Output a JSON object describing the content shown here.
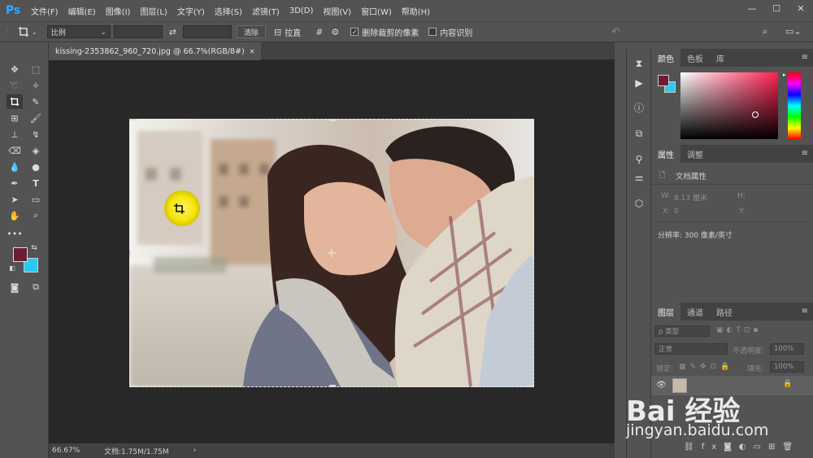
{
  "app": {
    "logo": "Ps"
  },
  "menu": [
    "文件(F)",
    "编辑(E)",
    "图像(I)",
    "图层(L)",
    "文字(Y)",
    "选择(S)",
    "滤镜(T)",
    "3D(D)",
    "视图(V)",
    "窗口(W)",
    "帮助(H)"
  ],
  "window_controls": {
    "minimize": "—",
    "maximize": "☐",
    "close": "✕"
  },
  "options": {
    "ratio": "比例",
    "clear_label": "清除",
    "straighten_label": "拉直",
    "delete_cropped_label": "删除裁剪的像素",
    "delete_cropped_checked": true,
    "content_aware_label": "内容识别",
    "content_aware_checked": false
  },
  "document": {
    "tab_title": "kissing-2353862_960_720.jpg @ 66.7%(RGB/8#)",
    "tab_close": "✕",
    "zoom": "66.67%",
    "doc_info": "文档:1.75M/1.75M",
    "status_arrow": "›"
  },
  "colors": {
    "foreground": "#6b1e33",
    "background": "#29c9f3",
    "accent": "#31a8ff",
    "highlight": "#f5e50a"
  },
  "color_panel": {
    "tabs": [
      "颜色",
      "色板",
      "库"
    ]
  },
  "properties_panel": {
    "tabs": [
      "属性",
      "调整"
    ],
    "section_title": "文档属性",
    "w_label": "W:",
    "w_value": "8.13 厘米",
    "h_label": "H:",
    "x_label": "X:",
    "x_value": "0",
    "y_label": "Y:",
    "resolution": "分辨率: 300 像素/英寸"
  },
  "layers_panel": {
    "tabs": [
      "图层",
      "通道",
      "路径"
    ],
    "filter_placeholder": "ρ 类型",
    "blend_mode": "正常",
    "opacity_label": "不透明度:",
    "opacity_value": "100%",
    "lock_label": "锁定:",
    "fill_label": "填充:",
    "fill_value": "100%"
  },
  "watermark": {
    "text": "Bai 经验",
    "url": "jingyan.baidu.com"
  }
}
